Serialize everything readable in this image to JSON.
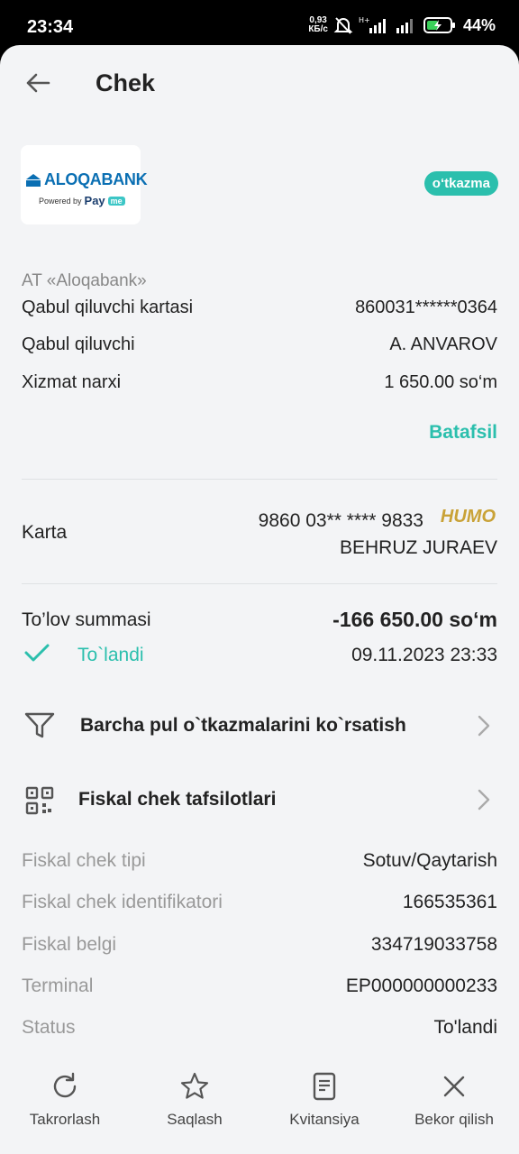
{
  "status_bar": {
    "time": "23:34",
    "net_speed_value": "0,93",
    "net_speed_unit": "КБ/с",
    "battery": "44%"
  },
  "header": {
    "title": "Chek"
  },
  "merchant": {
    "logo_text": "ALOQABANK",
    "powered_by": "Powered by",
    "payme_pay": "Pay",
    "payme_me": "me",
    "type_badge": "o‘tkazma",
    "bank_name": "AT «Aloqabank»"
  },
  "details": {
    "recipient_card_label": "Qabul qiluvchi kartasi",
    "recipient_card_value": "860031******0364",
    "recipient_label": "Qabul qiluvchi",
    "recipient_value": "A. ANVAROV",
    "fee_label": "Xizmat narxi",
    "fee_value": "1 650.00 so‘m",
    "more_link": "Batafsil"
  },
  "card": {
    "label": "Karta",
    "number": "9860 03** **** 9833",
    "brand": "HUMO",
    "holder": "BEHRUZ JURAEV"
  },
  "payment": {
    "sum_label": "To’lov summasi",
    "sum_value": "-166 650.00 so‘m",
    "status": "To`landi",
    "datetime": "09.11.2023 23:33"
  },
  "actions": {
    "all_transfers": "Barcha pul o`tkazmalarini ko`rsatish",
    "fiscal_details": "Fiskal chek tafsilotlari"
  },
  "fiscal": [
    {
      "label": "Fiskal chek tipi",
      "value": "Sotuv/Qaytarish"
    },
    {
      "label": "Fiskal chek identifikatori",
      "value": "166535361"
    },
    {
      "label": "Fiskal belgi",
      "value": "334719033758"
    },
    {
      "label": "Terminal",
      "value": "EP000000000233"
    },
    {
      "label": "Status",
      "value": "To'landi"
    }
  ],
  "bottom_bar": {
    "repeat": "Takrorlash",
    "save": "Saqlash",
    "receipt": "Kvitansiya",
    "cancel": "Bekor qilish"
  },
  "colors": {
    "accent": "#2bbfad",
    "background": "#f3f4f6",
    "humo_gold": "#c9a237",
    "bank_blue": "#0a6fb3"
  }
}
